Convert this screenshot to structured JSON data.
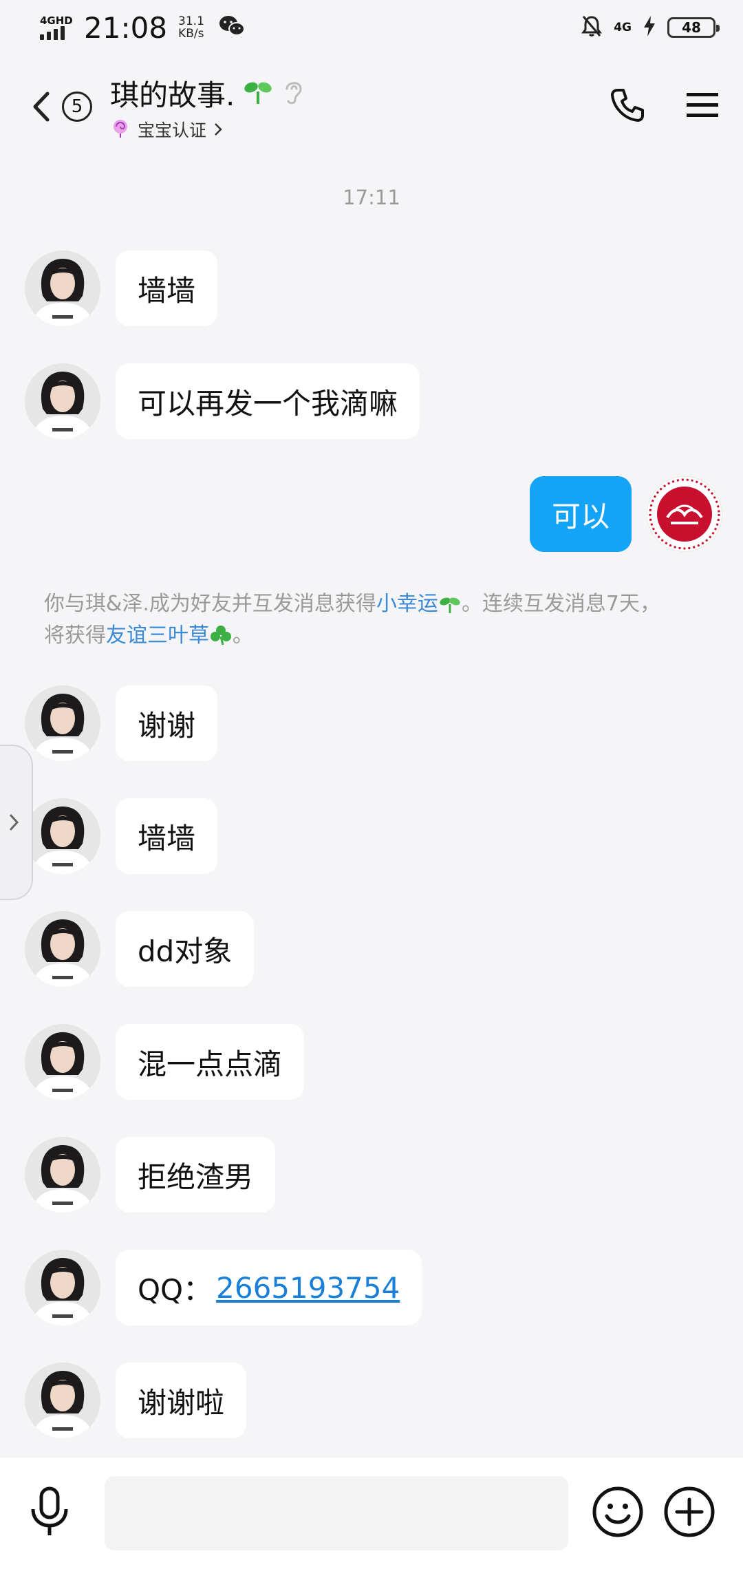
{
  "status_bar": {
    "network": "4GHD",
    "time": "21:08",
    "speed_value": "31.1",
    "speed_unit": "KB/s",
    "network_right": "4G",
    "battery": "48"
  },
  "header": {
    "unread_count": "5",
    "title": "琪的故事.",
    "subtitle": "宝宝认证"
  },
  "chat": {
    "timestamp": "17:11",
    "messages": [
      {
        "text": "墙墙"
      },
      {
        "text": "可以再发一个我滴嘛"
      },
      {
        "text": "可以"
      },
      {
        "text": "谢谢"
      },
      {
        "text": "墙墙"
      },
      {
        "text": "dd对象"
      },
      {
        "text": "混一点点滴"
      },
      {
        "text": "拒绝渣男"
      },
      {
        "text": "QQ：",
        "link": "2665193754"
      },
      {
        "text": "谢谢啦"
      }
    ],
    "notice": {
      "part1": "你与琪&泽.成为好友并互发消息获得",
      "link1": "小幸运",
      "part2": "。连续互发消息7天，将获得",
      "link2": "友谊三叶草",
      "part3": "。"
    }
  },
  "input": {
    "placeholder": ""
  },
  "colors": {
    "self_bubble": "#14a3f7",
    "link": "#3a8ad8",
    "background": "#f5f5f7"
  }
}
